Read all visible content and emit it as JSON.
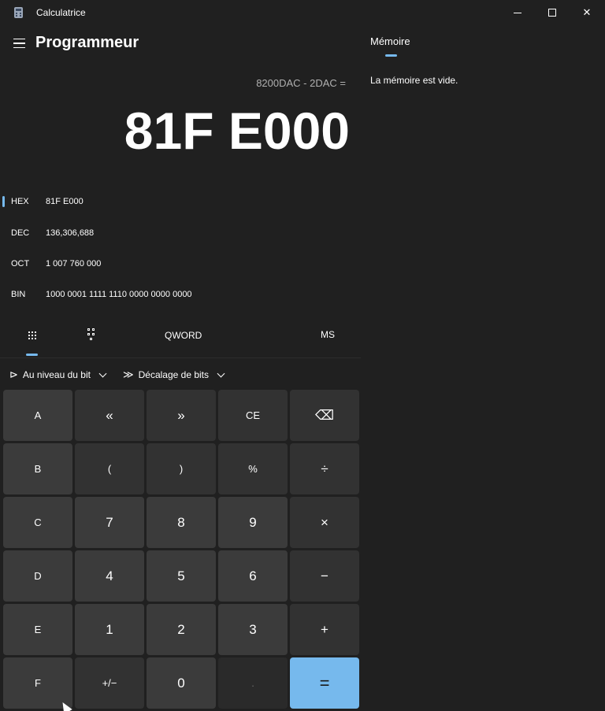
{
  "window": {
    "title": "Calculatrice",
    "minimize": "—",
    "maximize": "",
    "close": "✕"
  },
  "header": {
    "mode_title": "Programmeur"
  },
  "display": {
    "expression": "8200DAC - 2DAC =",
    "result": "81F E000"
  },
  "radix": [
    {
      "name": "HEX",
      "value": "81F E000",
      "active": true
    },
    {
      "name": "DEC",
      "value": "136,306,688",
      "active": false
    },
    {
      "name": "OCT",
      "value": "1 007 760 000",
      "active": false
    },
    {
      "name": "BIN",
      "value": "1000 0001 1111 1110 0000 0000 0000",
      "active": false
    }
  ],
  "tabs": {
    "word_size": "QWORD",
    "memory_store": "MS"
  },
  "dropdowns": {
    "bitwise": "Au niveau du bit",
    "bitshift": "Décalage de bits"
  },
  "keys": {
    "A": "A",
    "lsh": "«",
    "rsh": "»",
    "ce": "CE",
    "back": "⌫",
    "B": "B",
    "lparen": "(",
    "rparen": ")",
    "mod": "%",
    "div": "÷",
    "C": "C",
    "k7": "7",
    "k8": "8",
    "k9": "9",
    "mul": "×",
    "D": "D",
    "k4": "4",
    "k5": "5",
    "k6": "6",
    "sub": "−",
    "E": "E",
    "k1": "1",
    "k2": "2",
    "k3": "3",
    "add": "+",
    "F": "F",
    "neg": "+/−",
    "k0": "0",
    "dot": ".",
    "eq": "="
  },
  "memory": {
    "header": "Mémoire",
    "empty_text": "La mémoire est vide."
  },
  "colors": {
    "accent": "#76b9ed",
    "background": "#202020"
  }
}
